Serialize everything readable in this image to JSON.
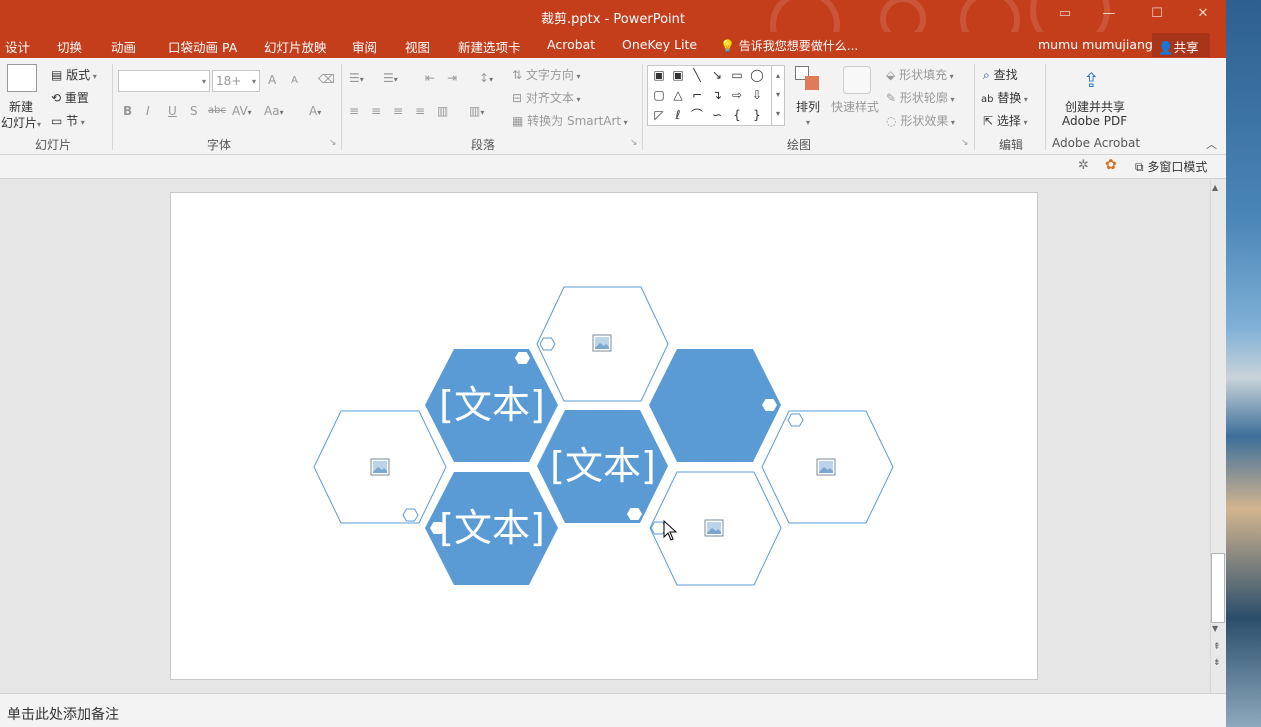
{
  "window": {
    "title": "裁剪.pptx - PowerPoint"
  },
  "menu": {
    "tabs": [
      "设计",
      "切换",
      "动画",
      "口袋动画 PA",
      "幻灯片放映",
      "审阅",
      "视图",
      "新建选项卡",
      "Acrobat",
      "OneKey Lite"
    ],
    "tell_me": "告诉我您想要做什么...",
    "user": "mumu mumujiang",
    "share": "共享"
  },
  "ribbon": {
    "slides": {
      "new_slide_1": "新建",
      "new_slide_2": "幻灯片",
      "layout": "版式",
      "reset": "重置",
      "section": "节",
      "label": "幻灯片"
    },
    "font": {
      "size": "18+",
      "label": "字体",
      "bold": "B",
      "italic": "I",
      "underline": "U",
      "shadow": "S",
      "strike": "abc",
      "spacing": "AV",
      "case": "Aa",
      "grow": "A",
      "shrink": "A",
      "color": "A"
    },
    "paragraph": {
      "text_direction": "文字方向",
      "align_text": "对齐文本",
      "smartart": "转换为 SmartArt",
      "label": "段落"
    },
    "drawing": {
      "arrange": "排列",
      "quick_styles": "快速样式",
      "fill": "形状填充",
      "outline": "形状轮廓",
      "effects": "形状效果",
      "label": "绘图"
    },
    "editing": {
      "find": "查找",
      "replace": "替换",
      "select": "选择",
      "label": "编辑"
    },
    "acrobat": {
      "create_1": "创建并共享",
      "create_2": "Adobe PDF",
      "label": "Adobe Acrobat"
    }
  },
  "cmdbar": {
    "multi_window": "多窗口模式"
  },
  "slide": {
    "text_placeholders": [
      "[文本]",
      "[文本]",
      "[文本]"
    ],
    "accent_color": "#5b9bd5",
    "outline_color": "#5b9bd5"
  },
  "notes": {
    "placeholder": "单击此处添加备注"
  }
}
